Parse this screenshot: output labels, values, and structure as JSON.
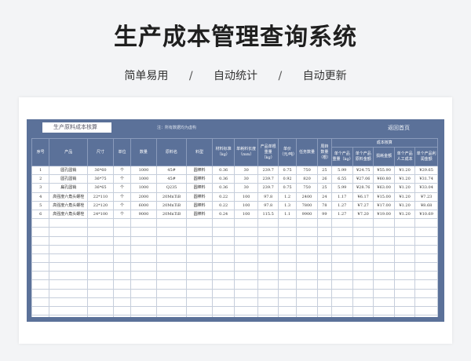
{
  "hero": {
    "title": "生产成本管理查询系统",
    "tags": [
      "简单易用",
      "自动统计",
      "自动更新"
    ],
    "separator": "/"
  },
  "toolbar": {
    "sheet_title": "生产原料成本核算",
    "note": "注：所有数据均为虚构",
    "return_label": "返回首页"
  },
  "table": {
    "headers": {
      "no": "序号",
      "product": "产品",
      "size": "尺寸",
      "unit": "单位",
      "qty": "数量",
      "material": "原料名",
      "model": "料型",
      "ratio": "材料标准（kg）",
      "loss": "单耗料长度（mm）",
      "unit_weight": "产品单根重量（kg）",
      "price": "单价（元/吨）",
      "batch": "任务数量",
      "days": "周转数量（根）",
      "cost_group": "成本核算",
      "c1": "单个产品重量（kg）",
      "c2": "单个产品原料金额",
      "c3": "损耗金额",
      "c4": "单个产品人工成本",
      "c5": "单个产品利润金额"
    },
    "rows": [
      [
        "1",
        "圆孔圆销",
        "36*60",
        "个",
        "1000",
        "45#",
        "圆棒料",
        "0.36",
        "30",
        "239.7",
        "0.75",
        "750",
        "25",
        "5.99",
        "¥24.75",
        "¥55.90",
        "¥1.20",
        "¥29.65"
      ],
      [
        "2",
        "圆孔圆销",
        "36*75",
        "个",
        "1000",
        "45#",
        "圆棒料",
        "0.36",
        "30",
        "239.7",
        "0.92",
        "820",
        "26",
        "6.55",
        "¥27.06",
        "¥60.80",
        "¥1.20",
        "¥31.74"
      ],
      [
        "3",
        "扁孔圆销",
        "36*65",
        "个",
        "1000",
        "Q235",
        "圆棒料",
        "0.36",
        "30",
        "239.7",
        "0.75",
        "750",
        "25",
        "5.99",
        "¥28.76",
        "¥63.00",
        "¥1.20",
        "¥33.04"
      ],
      [
        "4",
        "高强度六角头螺栓",
        "22*110",
        "个",
        "2000",
        "20MnTiB",
        "圆棒料",
        "0.22",
        "100",
        "97.8",
        "1.2",
        "2400",
        "24",
        "1.17",
        "¥6.17",
        "¥15.00",
        "¥1.20",
        "¥7.23"
      ],
      [
        "5",
        "高强度六角头螺栓",
        "22*120",
        "个",
        "6000",
        "20MnTiB",
        "圆棒料",
        "0.22",
        "100",
        "97.8",
        "1.3",
        "7800",
        "78",
        "1.27",
        "¥7.27",
        "¥17.00",
        "¥1.20",
        "¥8.68"
      ],
      [
        "6",
        "高强度六角头螺栓",
        "24*100",
        "个",
        "9000",
        "20MnTiB",
        "圆棒料",
        "0.24",
        "100",
        "115.5",
        "1.1",
        "9900",
        "99",
        "1.27",
        "¥7.20",
        "¥19.00",
        "¥1.20",
        "¥10.69"
      ]
    ],
    "empty_rows": 12
  },
  "colors": {
    "frame": "#5b7199",
    "header_bg": "#5b7199",
    "grid_line": "#c6cedb"
  }
}
